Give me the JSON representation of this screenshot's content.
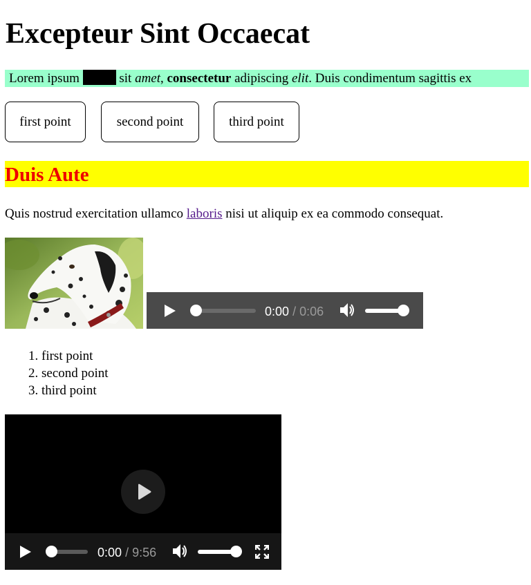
{
  "heading": "Excepteur Sint Occaecat",
  "intro": {
    "before": "Lorem ipsum",
    "after_redaction": "sit",
    "em1": "amet",
    "comma": ",",
    "strong": "consectetur",
    "middle": "adipiscing",
    "em2": "elit",
    "tail": ". Duis condimentum sagittis ex"
  },
  "buttons": [
    "first point",
    "second point",
    "third point"
  ],
  "subheading": "Duis Aute",
  "paragraph": {
    "before": "Quis nostrud exercitation ullamco",
    "link": "laboris",
    "after": "nisi ut aliquip ex ea commodo consequat."
  },
  "audio": {
    "current": "0:00",
    "separator": "/",
    "duration": "0:06",
    "progress": 0.0,
    "volume": 1.0
  },
  "list": [
    "first point",
    "second point",
    "third point"
  ],
  "video": {
    "current": "0:00",
    "separator": "/",
    "duration": "9:56",
    "progress": 0.0,
    "volume": 1.0
  },
  "colors": {
    "intro_bg": "#99ffcc",
    "subheading_bg": "#ffff00",
    "subheading_text": "#ee0000",
    "link": "#551a8b"
  }
}
